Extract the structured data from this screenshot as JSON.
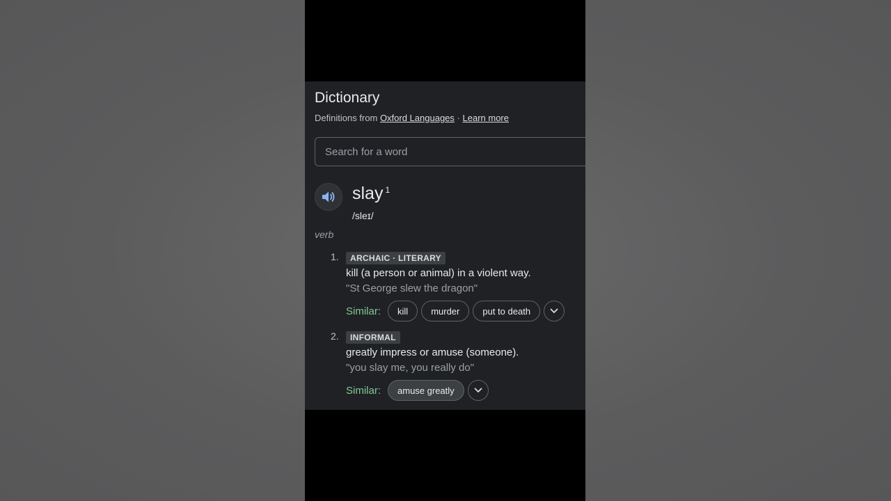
{
  "header": {
    "title": "Dictionary",
    "definitions_from": "Definitions from",
    "source_link": "Oxford Languages",
    "separator": "·",
    "learn_more": "Learn more"
  },
  "search": {
    "placeholder": "Search for a word",
    "value": ""
  },
  "entry": {
    "word": "slay",
    "homograph": "1",
    "phonetic": "/sleɪ/",
    "part_of_speech": "verb",
    "audio_icon": "speaker-icon",
    "senses": [
      {
        "number": "1.",
        "label": "ARCHAIC · LITERARY",
        "definition": "kill (a person or animal) in a violent way.",
        "example": "\"St George slew the dragon\"",
        "similar_label": "Similar:",
        "similar": [
          "kill",
          "murder",
          "put to death"
        ]
      },
      {
        "number": "2.",
        "label": "INFORMAL",
        "definition": "greatly impress or amuse (someone).",
        "example": "\"you slay me, you really do\"",
        "similar_label": "Similar:",
        "similar": [
          "amuse greatly"
        ]
      }
    ]
  },
  "colors": {
    "card_bg": "#202124",
    "similar_label": "#81c995",
    "speaker_icon": "#8ab4f8"
  }
}
